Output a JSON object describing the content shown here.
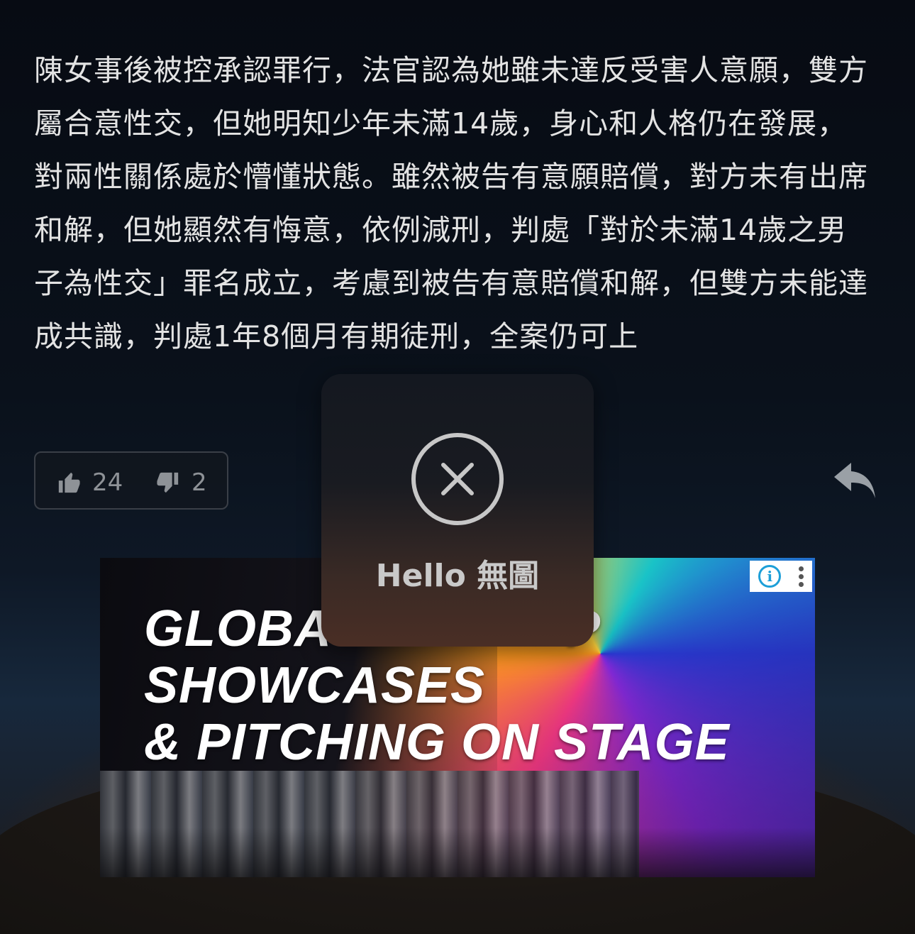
{
  "article": {
    "paragraph": "陳女事後被控承認罪行，法官認為她雖未達反受害人意願，雙方屬合意性交，但她明知少年未滿14歲，身心和人格仍在發展，對兩性關係處於懵懂狀態。雖然被告有意願賠償，對方未有出席和解，但她顯然有悔意，依例減刑，判處「對於未滿14歲之男子為性交」罪名成立，考慮到被告有意賠償和解，但雙方未能達成共識，判處1年8個月有期徒刑，全案仍可上"
  },
  "votes": {
    "up_count": "24",
    "down_count": "2",
    "up_icon": "thumbs-up-icon",
    "down_icon": "thumbs-down-icon"
  },
  "reply": {
    "icon": "reply-arrow-icon"
  },
  "ad": {
    "headline_line1": "GLOBA",
    "headline_line1_end": "P",
    "headline_line2": "SHOWCASES",
    "headline_line3": "& PITCHING ON STAGE",
    "info_icon": "info-icon",
    "menu_icon": "kebab-menu-icon"
  },
  "toast": {
    "icon": "close-circle-icon",
    "label": "Hello 無圖"
  },
  "colors": {
    "text": "#e3e3e3",
    "muted": "#8e9297",
    "info_blue": "#1d9fd8"
  }
}
